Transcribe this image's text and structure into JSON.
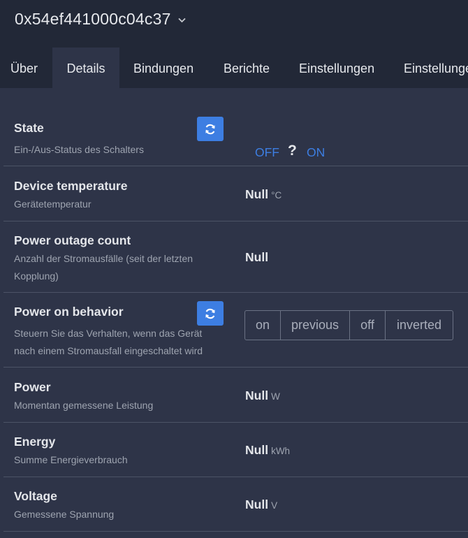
{
  "header": {
    "device_title": "0x54ef441000c04c37",
    "dropdown_icon": "chevron-down-icon",
    "tabs": [
      {
        "label": "Über",
        "active": false
      },
      {
        "label": "Details",
        "active": true
      },
      {
        "label": "Bindungen",
        "active": false
      },
      {
        "label": "Berichte",
        "active": false
      },
      {
        "label": "Einstellungen",
        "active": false
      },
      {
        "label": "Einstellungen",
        "active": false
      }
    ]
  },
  "colors": {
    "page_bg": "#2e3448",
    "header_bg": "#222837",
    "accent": "#3d7ee2",
    "muted_text": "#9ea4b0",
    "divider": "#4c5366"
  },
  "rows": {
    "state": {
      "name": "State",
      "description": "Ein-/Aus-Status des Schalters",
      "refresh_icon": "refresh-icon",
      "off_label": "OFF",
      "unknown_label": "?",
      "on_label": "ON"
    },
    "device_temperature": {
      "name": "Device temperature",
      "description": "Gerätetemperatur",
      "value": "Null",
      "unit": "°C"
    },
    "power_outage_count": {
      "name": "Power outage count",
      "description_line1": "Anzahl der Stromausfälle (seit der letzten",
      "description_line2": "Kopplung)",
      "value": "Null"
    },
    "power_on_behavior": {
      "name": "Power on behavior",
      "description_line1": "Steuern Sie das Verhalten, wenn das Gerät",
      "description_line2": "nach einem Stromausfall eingeschaltet wird",
      "refresh_icon": "refresh-icon",
      "options": [
        "on",
        "previous",
        "off",
        "inverted"
      ]
    },
    "power": {
      "name": "Power",
      "description": "Momentan gemessene Leistung",
      "value": "Null",
      "unit": "W"
    },
    "energy": {
      "name": "Energy",
      "description": "Summe Energieverbrauch",
      "value": "Null",
      "unit": "kWh"
    },
    "voltage": {
      "name": "Voltage",
      "description": "Gemessene Spannung",
      "value": "Null",
      "unit": "V"
    }
  }
}
